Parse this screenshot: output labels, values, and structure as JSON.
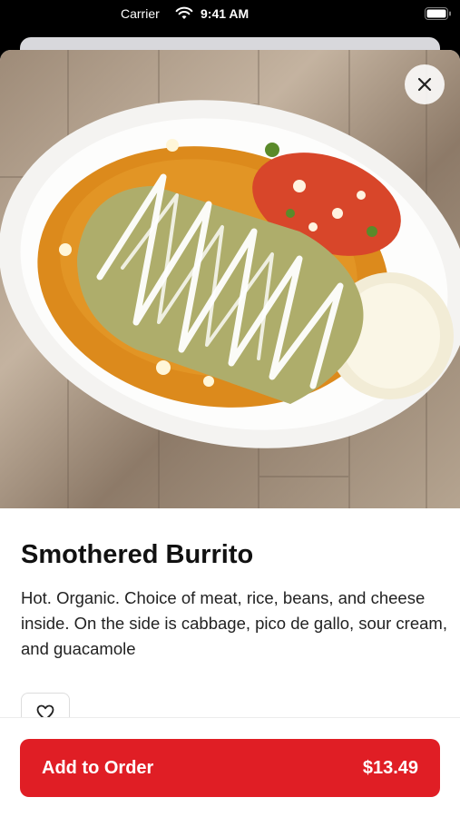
{
  "status_bar": {
    "carrier": "Carrier",
    "time": "9:41 AM"
  },
  "item": {
    "name": "Smothered Burrito",
    "description": "Hot. Organic. Choice of meat, rice, beans, and cheese inside. On the side is cabbage, pico de gallo, sour cream, and guacamole",
    "image": "burrito-photo"
  },
  "actions": {
    "add_to_order_label": "Add to Order",
    "price": "$13.49"
  },
  "icons": {
    "close": "close-icon",
    "favorite": "heart-icon"
  },
  "colors": {
    "accent": "#e01e25"
  }
}
